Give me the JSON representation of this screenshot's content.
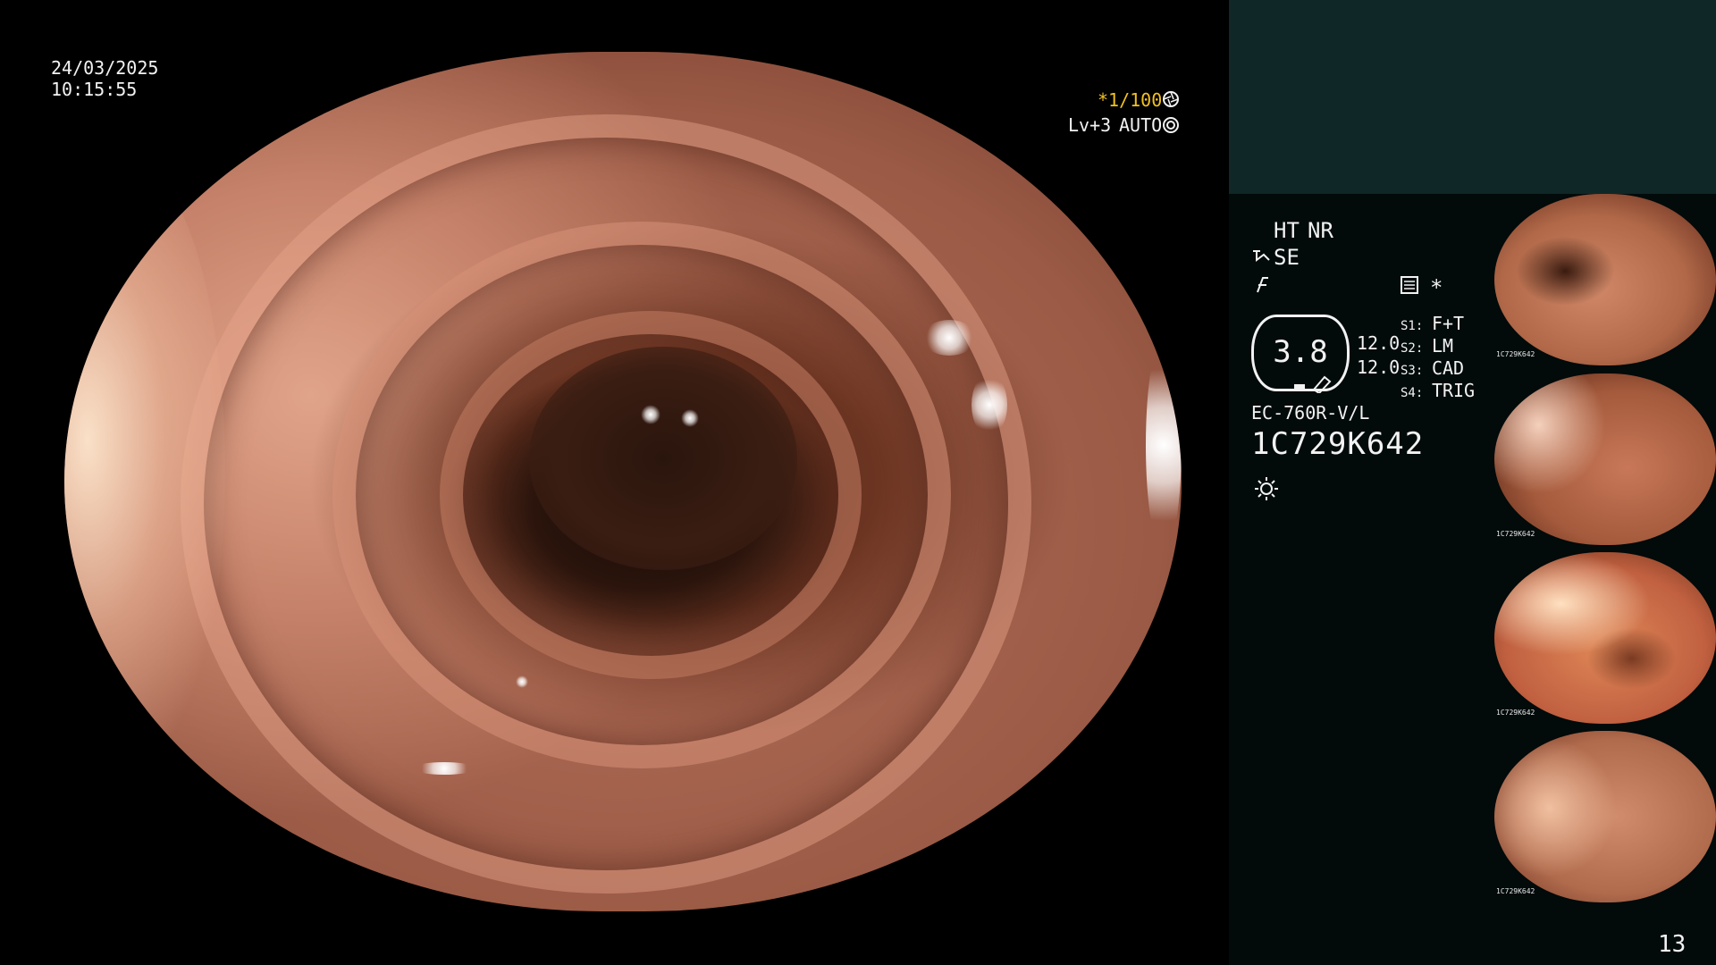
{
  "osd": {
    "date": "24/03/2025",
    "time": "10:15:55",
    "shutter": "*1/100",
    "level": "Lv+3",
    "iris_mode": "AUTO"
  },
  "settings": {
    "ht": "HT",
    "nr": "NR",
    "se": "SE",
    "asterisk": "*",
    "scale_value": "3.8",
    "zoom_values": [
      "12.0",
      "12.0"
    ],
    "switches": [
      {
        "key": "S1",
        "value": "F+T"
      },
      {
        "key": "S2",
        "value": "LM"
      },
      {
        "key": "S3",
        "value": "CAD"
      },
      {
        "key": "S4",
        "value": "TRIG"
      }
    ],
    "scope_model": "EC-760R-V/L",
    "scope_serial": "1C729K642"
  },
  "thumbnails": [
    {
      "caption": "1C729K642"
    },
    {
      "caption": "1C729K642"
    },
    {
      "caption": "1C729K642"
    },
    {
      "caption": "1C729K642"
    }
  ],
  "page_number": "13",
  "icons": {
    "shutter": "aperture-icon",
    "auto": "iris-icon",
    "se": "structure-enhance-icon",
    "color": "color-mode-icon",
    "settings": "settings-grid-icon",
    "light": "light-source-icon"
  },
  "colors": {
    "accent_yellow": "#f0c020",
    "panel_top": "#0f2727",
    "panel": "#020a0a"
  }
}
